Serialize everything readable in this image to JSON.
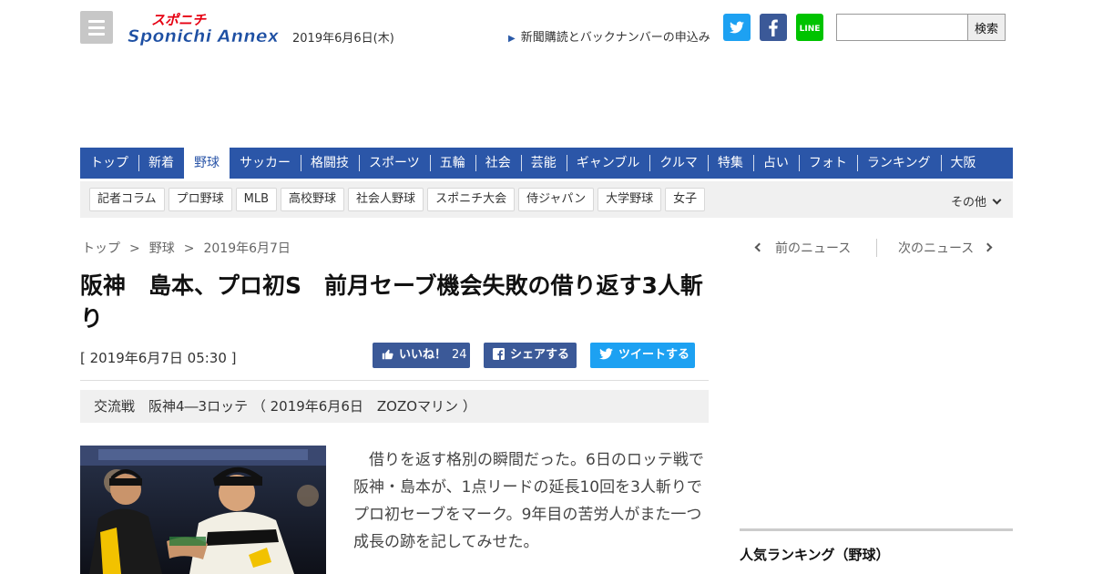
{
  "header": {
    "logo_text": "Sponichi Annex",
    "logo_kana": "スポニチ",
    "date": "2019年6月6日(木)",
    "subscribe_link": "新聞購読とバックナンバーの申込み",
    "search_placeholder": "",
    "search_button": "検索",
    "line_label": "LINE"
  },
  "nav": {
    "items": [
      "トップ",
      "新着",
      "野球",
      "サッカー",
      "格闘技",
      "スポーツ",
      "五輪",
      "社会",
      "芸能",
      "ギャンブル",
      "クルマ",
      "特集",
      "占い",
      "フォト",
      "ランキング",
      "大阪"
    ],
    "active": "野球"
  },
  "subnav": {
    "items": [
      "記者コラム",
      "プロ野球",
      "MLB",
      "高校野球",
      "社会人野球",
      "スポニチ大会",
      "侍ジャパン",
      "大学野球",
      "女子"
    ],
    "more": "その他"
  },
  "breadcrumb": {
    "items": [
      "トップ",
      "野球",
      "2019年6月7日"
    ],
    "separator": ">"
  },
  "pager": {
    "prev": "前のニュース",
    "next": "次のニュース"
  },
  "article": {
    "title": "阪神　島本、プロ初S　前月セーブ機会失敗の借り返す3人斬り",
    "timestamp": "[ 2019年6月7日 05:30 ]",
    "game_info": "交流戦　阪神4―3ロッテ （ 2019年6月6日　ZOZOマリン ）",
    "body": "借りを返す格別の瞬間だった。6日のロッテ戦で阪神・島本が、1点リードの延長10回を3人斬りでプロ初セーブをマーク。9年目の苦労人がまた一つ成長の跡を記してみせた。"
  },
  "share": {
    "like_label": "いいね！",
    "like_count": "24",
    "facebook_label": "シェアする",
    "twitter_label": "ツイートする"
  },
  "sidebar": {
    "ranking_title": "人気ランキング（野球）"
  },
  "colors": {
    "nav_blue": "#2b56a8",
    "facebook": "#3b5998",
    "twitter": "#1da1f2",
    "line": "#00c300"
  }
}
